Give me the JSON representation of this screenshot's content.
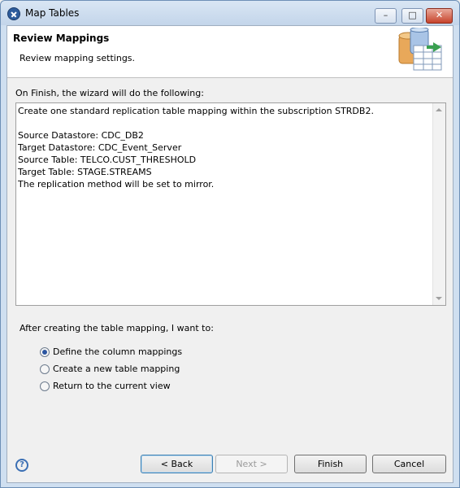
{
  "window": {
    "title": "Map Tables",
    "min_glyph": "–",
    "max_glyph": "□",
    "close_glyph": "✕"
  },
  "header": {
    "title": "Review Mappings",
    "description": "Review mapping settings."
  },
  "summary": {
    "label": "On Finish, the wizard will do the following:",
    "lines": [
      "Create one standard replication table mapping within the subscription STRDB2.",
      "",
      "Source Datastore: CDC_DB2",
      "Target Datastore: CDC_Event_Server",
      "Source Table: TELCO.CUST_THRESHOLD",
      "Target Table: STAGE.STREAMS",
      "The replication method will be set to mirror."
    ]
  },
  "after": {
    "label": "After creating the table mapping, I want to:",
    "options": [
      {
        "label": "Define the column mappings",
        "checked": true
      },
      {
        "label": "Create a new table mapping",
        "checked": false
      },
      {
        "label": "Return to the current view",
        "checked": false
      }
    ]
  },
  "buttons": {
    "back": "< Back",
    "next": "Next >",
    "finish": "Finish",
    "cancel": "Cancel"
  }
}
